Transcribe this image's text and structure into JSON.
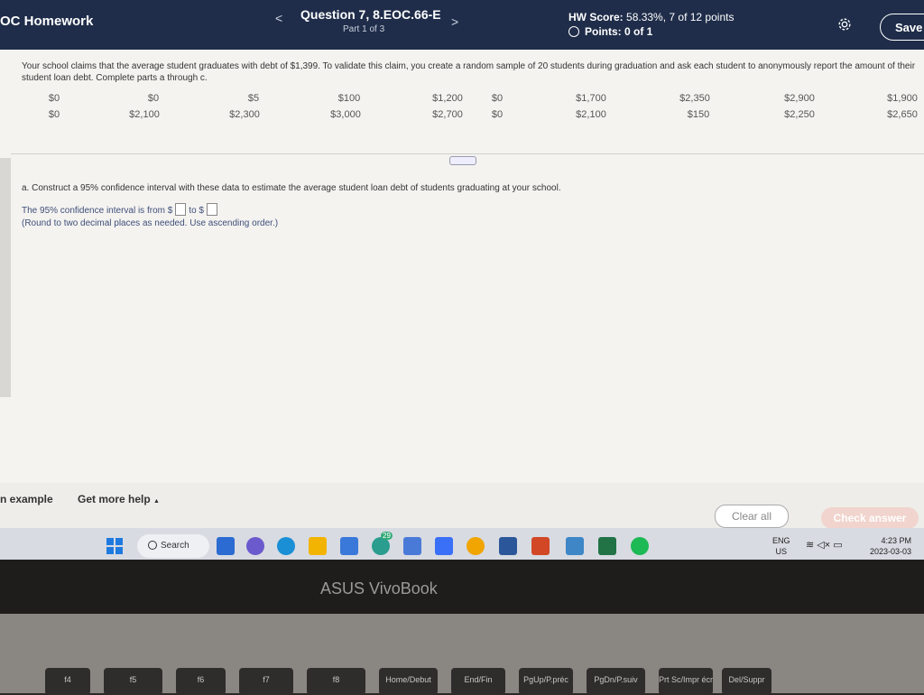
{
  "header": {
    "app_title": "OC Homework",
    "question_title": "Question 7, 8.EOC.66-E",
    "question_part": "Part 1 of 3",
    "hw_score_label": "HW Score:",
    "hw_score_value": "58.33%, 7 of 12 points",
    "points_label": "Points: 0 of 1",
    "save_label": "Save",
    "prev_label": "<",
    "next_label": ">"
  },
  "problem": {
    "intro": "Your school claims that the average student graduates with debt of $1,399. To validate this claim, you create a random sample of 20 students during graduation and ask each student to anonymously report the amount of their student loan debt. Complete parts a through c.",
    "data_row1": [
      "$0",
      "$0",
      "$5",
      "$100",
      "$1,200",
      "$0",
      "$1,700",
      "$2,350",
      "$2,900",
      "$1,900"
    ],
    "data_row2": [
      "$0",
      "$2,100",
      "$2,300",
      "$3,000",
      "$2,700",
      "$0",
      "$2,100",
      "$150",
      "$2,250",
      "$2,650"
    ],
    "part_a": "a. Construct a 95% confidence interval with these data to estimate the average student loan debt of students graduating at your school.",
    "ci_prefix": "The 95% confidence interval is from $",
    "ci_mid": "to $",
    "round_note": "(Round to two decimal places as needed. Use ascending order.)"
  },
  "footer": {
    "example_label": "n example",
    "help_label": "Get more help",
    "help_arrow": "▲",
    "clear_label": "Clear all",
    "check_label": "Check answer"
  },
  "taskbar": {
    "search_label": "Search",
    "badge_count": "29",
    "lang_line1": "ENG",
    "lang_line2": "US",
    "time": "4:23 PM",
    "date": "2023-03-03"
  },
  "device": {
    "brand": "ASUS VivoBook",
    "keys": [
      "f4",
      "f5",
      "f6",
      "f7",
      "f8",
      "Home/Debut",
      "End/Fin",
      "PgUp/P.préc",
      "PgDn/P.suiv",
      "Prt Sc/Impr écr",
      "Del/Suppr"
    ]
  }
}
